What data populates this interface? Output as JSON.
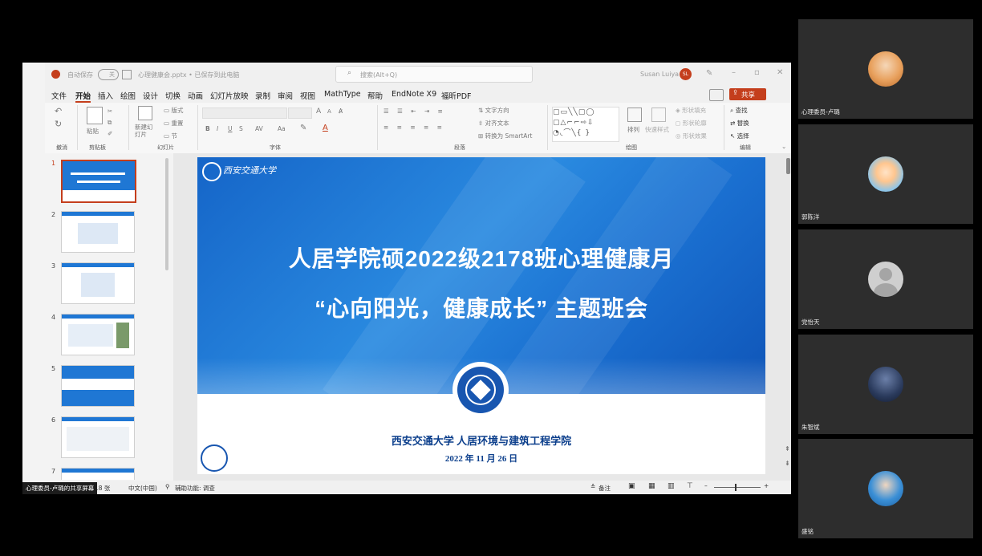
{
  "titlebar": {
    "autosave": "自动保存",
    "toggle": "关",
    "filename": "心理健康会.pptx • 已保存到此电脑",
    "search_placeholder": "搜索(Alt+Q)",
    "user": "Susan Luiya",
    "user_initials": "SL"
  },
  "menu": [
    "文件",
    "开始",
    "插入",
    "绘图",
    "设计",
    "切换",
    "动画",
    "幻灯片放映",
    "录制",
    "审阅",
    "视图",
    "MathType",
    "帮助",
    "EndNote X9",
    "福昕PDF"
  ],
  "menu_active": "开始",
  "share_button": "共享",
  "ribbon": {
    "undo_group": "撤消",
    "clipboard": {
      "paste": "粘贴",
      "group": "剪贴板"
    },
    "slides": {
      "new_slide": "新建幻灯片",
      "layout": "版式",
      "reset": "重置",
      "section": "节",
      "group": "幻灯片"
    },
    "font": {
      "group": "字体",
      "size_up": "A",
      "size_down": "A",
      "bold": "B",
      "italic": "I",
      "underline": "U",
      "strike": "S",
      "spacing": "AV",
      "case": "Aa"
    },
    "paragraph": {
      "group": "段落",
      "text_direction": "文字方向",
      "align_text": "对齐文本",
      "smartart": "转换为 SmartArt"
    },
    "drawing": {
      "group": "绘图",
      "arrange": "排列",
      "quick_styles": "快速样式",
      "shape_fill": "形状填充",
      "shape_outline": "形状轮廓",
      "shape_effects": "形状效果"
    },
    "editing": {
      "group": "编辑",
      "find": "查找",
      "replace": "替换",
      "select": "选择"
    }
  },
  "thumbnails": [
    "1",
    "2",
    "3",
    "4",
    "5",
    "6",
    "7"
  ],
  "slide": {
    "university_logo_text": "西安交通大学",
    "title_line1": "人居学院硕2022级2178班心理健康月",
    "title_line2": "“心向阳光，健康成长” 主题班会",
    "org": "西安交通大学 人居环境与建筑工程学院",
    "date": "2022 年 11 月 26 日"
  },
  "statusbar": {
    "sharing": "心理委员-卢璐的共享屏幕",
    "slide_count": "18 张",
    "language": "中文(中国)",
    "accessibility": "辅助功能: 调查",
    "notes": "备注"
  },
  "participants": [
    {
      "name": "心理委员-卢璐",
      "avatar": "girl-photo",
      "color": "#e8a05c"
    },
    {
      "name": "郭陈洋",
      "avatar": "cartoon-boy",
      "color": "#8ec5e8"
    },
    {
      "name": "党怡天",
      "avatar": "default-avatar",
      "color": "#cfcfcf"
    },
    {
      "name": "朱智斌",
      "avatar": "night-city",
      "color": "#2a3a5c"
    },
    {
      "name": "盛铭",
      "avatar": "boy-sea",
      "color": "#3a8fd6"
    }
  ],
  "colors": {
    "accent": "#c43e1c",
    "slide_blue": "#1f77d4",
    "slide_dark": "#0c3f8c"
  }
}
